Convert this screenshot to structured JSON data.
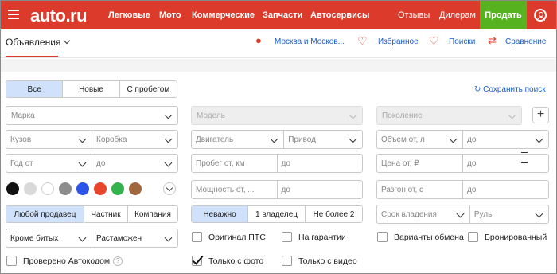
{
  "header": {
    "logo": "auto.ru",
    "nav": [
      "Легковые",
      "Мото",
      "Коммерческие",
      "Запчасти",
      "Автосервисы"
    ],
    "reviews": "Отзывы",
    "dealers": "Дилерам",
    "sell": "Продать",
    "accent_color": "#dc3a2a",
    "sell_color": "#56b21f"
  },
  "subheader": {
    "section": "Объявления",
    "location": "Москва и Москов...",
    "favorites": "Избранное",
    "searches": "Поиски",
    "compare": "Сравнение"
  },
  "filters": {
    "condition_tabs": [
      "Все",
      "Новые",
      "С пробегом"
    ],
    "condition_selected": "Все",
    "save_search": "Сохранить поиск",
    "brand": "Марка",
    "model": "Модель",
    "generation": "Поколение",
    "body": "Кузов",
    "gearbox": "Коробка",
    "engine": "Двигатель",
    "drive": "Привод",
    "volume_from": "Объем от, л",
    "volume_to": "до",
    "year_from": "Год от",
    "year_to": "до",
    "mileage_from": "Пробег от, км",
    "mileage_to": "до",
    "price_from": "Цена от, ₽",
    "price_to": "до",
    "power_from": "Мощность от, ...",
    "power_to": "до",
    "accel_from": "Разгон от, с",
    "accel_to": "до",
    "seller_tabs": [
      "Любой продавец",
      "Частник",
      "Компания"
    ],
    "owners_tabs": [
      "Неважно",
      "1 владелец",
      "Не более 2"
    ],
    "ownership": "Срок владения",
    "wheel": "Руль",
    "damage": "Кроме битых",
    "customs": "Растаможен",
    "original_pts": "Оригинал ПТС",
    "warranty": "На гарантии",
    "exchange": "Варианты обмена",
    "booked": "Бронированный",
    "autocode": "Проверено Автокодом",
    "with_photo": "Только с фото",
    "with_video": "Только с видео",
    "colors": [
      "#111111",
      "#d9d9d9",
      "#ffffff",
      "#8c8c8c",
      "#2c55e8",
      "#e8452c",
      "#34b24b",
      "#a0673f"
    ]
  }
}
